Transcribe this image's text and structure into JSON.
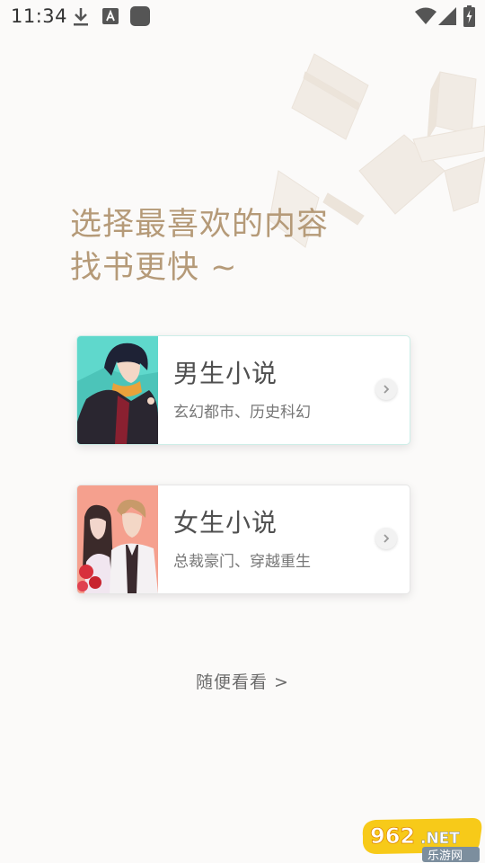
{
  "status_bar": {
    "time": "11:34",
    "left_icons": [
      "download-icon",
      "a-notification-icon",
      "app-square-icon"
    ],
    "right_icons": [
      "wifi-icon",
      "cell-signal-icon",
      "battery-charging-icon"
    ]
  },
  "headline": {
    "line1": "选择最喜欢的内容",
    "line2": "找书更快 ~"
  },
  "cards": [
    {
      "title": "男生小说",
      "subtitle": "玄幻都市、历史科幻",
      "accent": "#5fd8cc"
    },
    {
      "title": "女生小说",
      "subtitle": "总裁豪门、穿越重生",
      "accent": "#f5a08e"
    }
  ],
  "browse_link": "随便看看 >",
  "watermark": {
    "top": "962.NET",
    "bottom": "乐游网"
  },
  "colors": {
    "background": "#fbfaf9",
    "headline": "#b59a78",
    "title_text": "#505050"
  }
}
